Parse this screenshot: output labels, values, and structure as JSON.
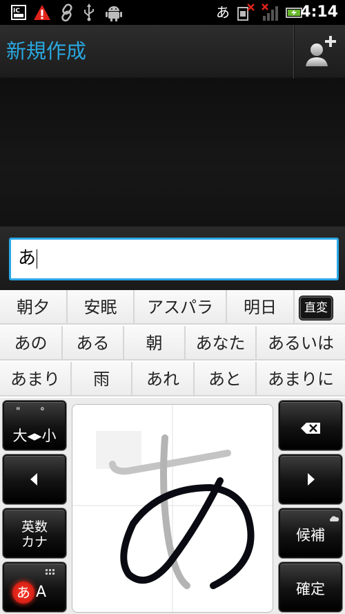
{
  "status_bar": {
    "ime_indicator": "あ",
    "clock": "4:14",
    "icons": [
      "ic-tag-icon",
      "warning-icon",
      "link-icon",
      "usb-icon",
      "android-debug-icon",
      "sim-error-icon",
      "signal-no-service-icon",
      "battery-charging-icon"
    ]
  },
  "header": {
    "title": "新規作成",
    "add_contact_icon": "add-contact-icon"
  },
  "compose": {
    "value": "あ"
  },
  "candidates": {
    "row1": [
      "朝夕",
      "安眠",
      "アスパラ",
      "明日"
    ],
    "convert_label": "直変",
    "row2": [
      "あの",
      "ある",
      "朝",
      "あなた",
      "あるいは"
    ],
    "row3": [
      "あまり",
      "雨",
      "あれ",
      "あと",
      "あまりに"
    ]
  },
  "keyboard": {
    "case_key": {
      "top": "\" °",
      "label": "大◂▸小"
    },
    "left_key_icon": "arrow-left-icon",
    "mode_key": {
      "line1": "英数",
      "line2": "カナ"
    },
    "input_mode_key": {
      "kana": "あ",
      "alpha": "A"
    },
    "backspace_icon": "backspace-icon",
    "right_key_icon": "arrow-right-icon",
    "candidate_key": "候補",
    "confirm_key": "確定",
    "handwriting_glyph": "あ"
  },
  "colors": {
    "accent": "#29a8e0",
    "input_border": "#2ba8e8",
    "mode_badge": "#e0231b"
  }
}
